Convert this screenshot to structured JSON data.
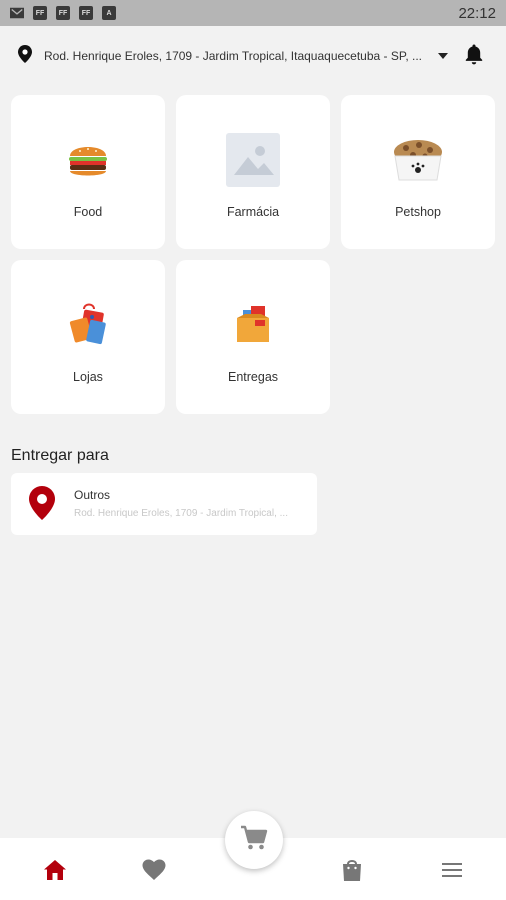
{
  "status_bar": {
    "time": "22:12",
    "icons": [
      "mail-icon",
      "ff-icon",
      "ff-icon",
      "ff-icon",
      "a-icon"
    ],
    "icon_labels": [
      "FF",
      "FF",
      "FF",
      "A"
    ]
  },
  "address_bar": {
    "address": "Rod. Henrique Eroles, 1709 - Jardim Tropical, Itaquaquecetuba - SP, ..."
  },
  "categories": [
    {
      "label": "Food",
      "icon": "burger-icon"
    },
    {
      "label": "Farmácia",
      "icon": "image-placeholder-icon"
    },
    {
      "label": "Petshop",
      "icon": "pet-bowl-icon"
    },
    {
      "label": "Lojas",
      "icon": "shopping-bags-icon"
    },
    {
      "label": "Entregas",
      "icon": "delivery-box-icon"
    }
  ],
  "delivery": {
    "title": "Entregar para",
    "saved_address": {
      "name": "Outros",
      "address": "Rod. Henrique Eroles, 1709 - Jardim Tropical, ..."
    }
  },
  "bottom_nav": {
    "items": [
      "home-icon",
      "heart-icon",
      "cart-icon",
      "bag-icon",
      "menu-icon"
    ],
    "active_color": "#b3000c",
    "inactive_color": "#777777"
  },
  "colors": {
    "accent": "#b3000c",
    "background": "#f2f2f2"
  }
}
